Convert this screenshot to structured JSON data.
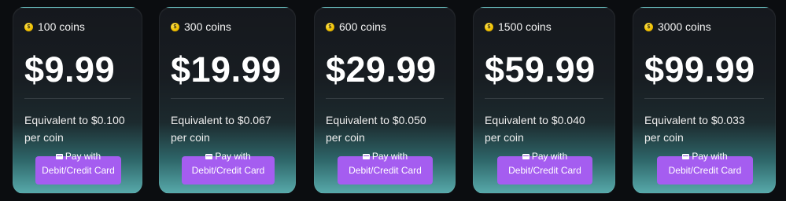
{
  "plans": [
    {
      "coins_label": "100 coins",
      "price": "$9.99",
      "equivalent": "Equivalent to $0.100 per coin",
      "button_label": "Pay with Debit/Credit Card"
    },
    {
      "coins_label": "300 coins",
      "price": "$19.99",
      "equivalent": "Equivalent to $0.067 per coin",
      "button_label": "Pay with Debit/Credit Card"
    },
    {
      "coins_label": "600 coins",
      "price": "$29.99",
      "equivalent": "Equivalent to $0.050 per coin",
      "button_label": "Pay with Debit/Credit Card"
    },
    {
      "coins_label": "1500 coins",
      "price": "$59.99",
      "equivalent": "Equivalent to $0.040 per coin",
      "button_label": "Pay with Debit/Credit Card"
    },
    {
      "coins_label": "3000 coins",
      "price": "$99.99",
      "equivalent": "Equivalent to $0.033 per coin",
      "button_label": "Pay with Debit/Credit Card"
    }
  ],
  "icons": {
    "coin": "coin-icon",
    "payment_card": "credit-card-icon"
  },
  "colors": {
    "page_background": "#0b0d10",
    "card_top": "#15181d",
    "card_bottom_glow": "#57a9aa",
    "button": "#a55df0",
    "coin": "#f2c300"
  }
}
